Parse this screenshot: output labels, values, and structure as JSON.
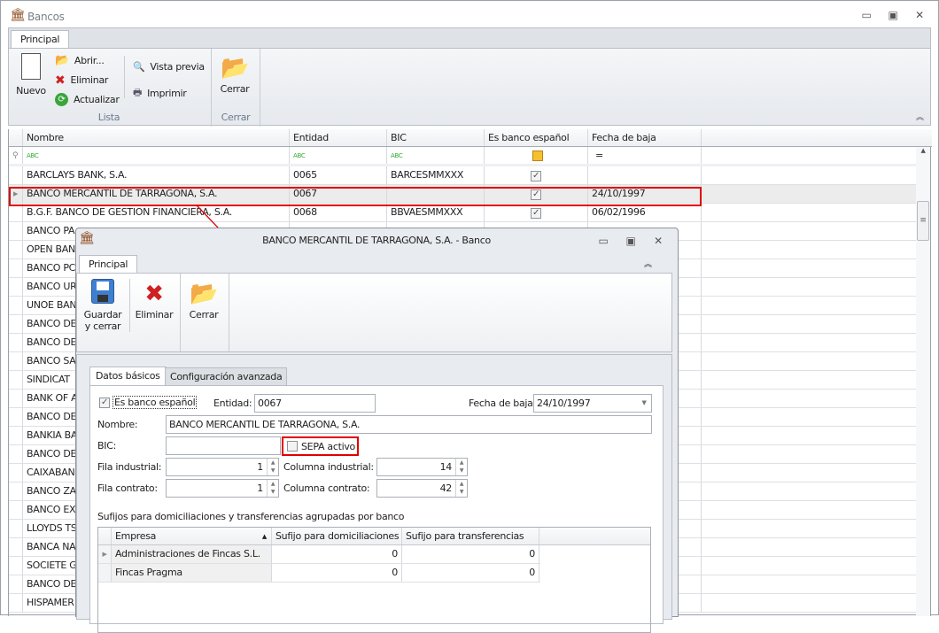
{
  "window": {
    "title": "Bancos",
    "minimize": "▭",
    "maximize": "▣",
    "close": "✕"
  },
  "ribbon": {
    "tab": "Principal",
    "nuevo": "Nuevo",
    "abrir": "Abrir...",
    "eliminar": "Eliminar",
    "actualizar": "Actualizar",
    "vista_previa": "Vista previa",
    "imprimir": "Imprimir",
    "cerrar": "Cerrar",
    "group_lista": "Lista",
    "group_cerrar": "Cerrar",
    "collapse": "︽"
  },
  "grid": {
    "columns": [
      "Nombre",
      "Entidad",
      "BIC",
      "Es banco español",
      "Fecha de baja"
    ],
    "filter_abc": "ABC",
    "filter_eq": "=",
    "rows": [
      {
        "nombre": "BARCLAYS BANK, S.A.",
        "entidad": "0065",
        "bic": "BARCESMMXXX",
        "es": true,
        "fecha": ""
      },
      {
        "nombre": "BANCO MERCANTIL DE TARRAGONA, S.A.",
        "entidad": "0067",
        "bic": "",
        "es": true,
        "fecha": "24/10/1997",
        "selected": true
      },
      {
        "nombre": "B.G.F. BANCO DE GESTION FINANCIERA, S.A.",
        "entidad": "0068",
        "bic": "BBVAESMMXXX",
        "es": true,
        "fecha": "06/02/1996"
      },
      {
        "nombre": "BANCO PA"
      },
      {
        "nombre": "OPEN BAN"
      },
      {
        "nombre": "BANCO PC"
      },
      {
        "nombre": "BANCO UR"
      },
      {
        "nombre": "UNOE BAN"
      },
      {
        "nombre": "BANCO DE"
      },
      {
        "nombre": "BANCO DE"
      },
      {
        "nombre": "BANCO SA"
      },
      {
        "nombre": "SINDICAT"
      },
      {
        "nombre": "BANK OF A"
      },
      {
        "nombre": "BANCO DE"
      },
      {
        "nombre": "BANKIA BA"
      },
      {
        "nombre": "BANCO DE"
      },
      {
        "nombre": "CAIXABAN"
      },
      {
        "nombre": "BANCO ZA"
      },
      {
        "nombre": "BANCO EX"
      },
      {
        "nombre": "LLOYDS TS"
      },
      {
        "nombre": "BANCA NA"
      },
      {
        "nombre": "SOCIETE G"
      },
      {
        "nombre": "BANCO DE"
      },
      {
        "nombre": "HISPAMER"
      }
    ]
  },
  "dialog": {
    "title": "BANCO MERCANTIL DE TARRAGONA, S.A. - Banco",
    "tab": "Principal",
    "guardar": "Guardar\ny cerrar",
    "eliminar": "Eliminar",
    "cerrar": "Cerrar",
    "tabs": [
      "Datos básicos",
      "Configuración avanzada"
    ],
    "es_banco_label": "Es banco español",
    "entidad_label": "Entidad:",
    "entidad": "0067",
    "fecha_label": "Fecha de baja:",
    "fecha": "24/10/1997",
    "nombre_label": "Nombre:",
    "nombre": "BANCO MERCANTIL DE TARRAGONA, S.A.",
    "bic_label": "BIC:",
    "bic": "",
    "sepa_label": "SEPA activo",
    "fila_ind_label": "Fila industrial:",
    "fila_ind": "1",
    "col_ind_label": "Columna industrial:",
    "col_ind": "14",
    "fila_con_label": "Fila contrato:",
    "fila_con": "1",
    "col_con_label": "Columna contrato:",
    "col_con": "42",
    "sufijos_title": "Sufijos para domiciliaciones y transferencias agrupadas por banco",
    "sub_columns": [
      "Empresa",
      "Sufijo para domiciliaciones",
      "Sufijo para transferencias"
    ],
    "sub_rows": [
      [
        "Administraciones de Fincas S.L.",
        "0",
        "0"
      ],
      [
        "Fincas Pragma",
        "0",
        "0"
      ]
    ]
  },
  "colors": {
    "highlight": "#e00000"
  }
}
